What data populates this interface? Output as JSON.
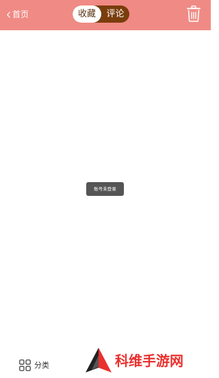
{
  "header": {
    "back_label": "首页",
    "tabs": [
      {
        "label": "收藏",
        "active": true
      },
      {
        "label": "评论",
        "active": false
      }
    ]
  },
  "toast": {
    "message": "账号未登录"
  },
  "bottom_bar": {
    "category_label": "分类"
  },
  "watermark": {
    "text": "科维手游网"
  },
  "colors": {
    "header_bg": "#f08a84",
    "segment_bg": "#7a3d0c",
    "watermark_red": "#e8312f"
  }
}
